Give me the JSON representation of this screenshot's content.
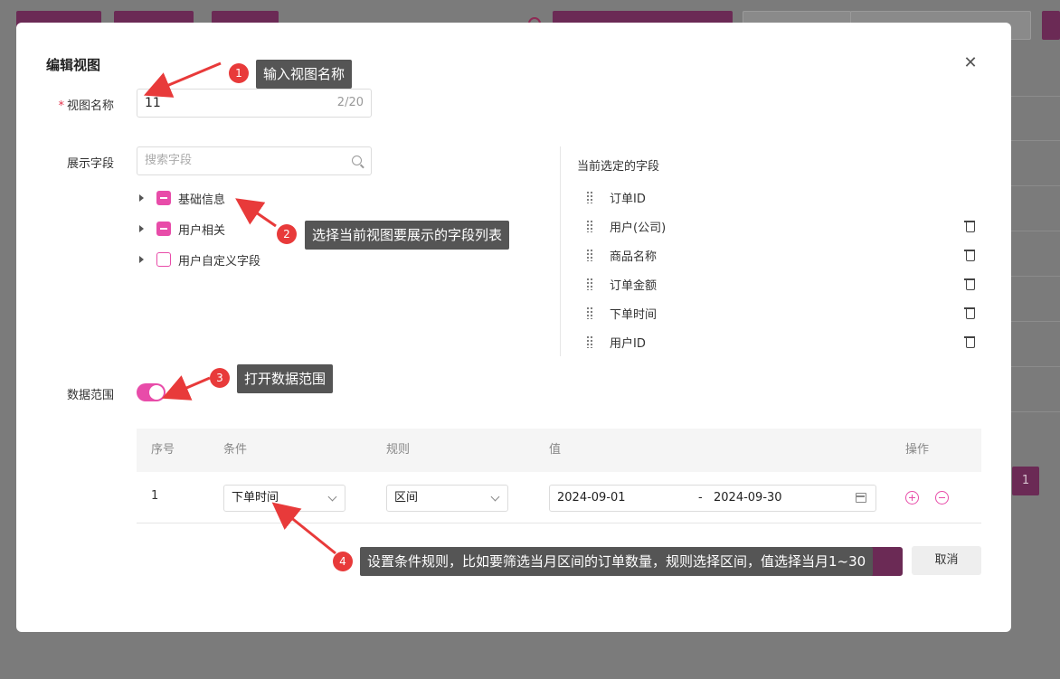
{
  "modal": {
    "title": "编辑视图",
    "close_icon": "close-icon",
    "name_label": "视图名称",
    "name_value": "11",
    "name_count": "2/20",
    "fields_label": "展示字段",
    "search_placeholder": "搜索字段",
    "tree": [
      {
        "label": "基础信息",
        "state": "partial"
      },
      {
        "label": "用户相关",
        "state": "partial"
      },
      {
        "label": "用户自定义字段",
        "state": "unchecked"
      }
    ],
    "selected_title": "当前选定的字段",
    "selected_fields": [
      {
        "label": "订单ID"
      },
      {
        "label": "用户(公司)"
      },
      {
        "label": "商品名称"
      },
      {
        "label": "订单金额"
      },
      {
        "label": "下单时间"
      },
      {
        "label": "用户ID"
      }
    ],
    "range_label": "数据范围",
    "range_enabled": true,
    "table": {
      "headers": [
        "序号",
        "条件",
        "规则",
        "值",
        "操作"
      ],
      "rows": [
        {
          "index": "1",
          "condition": "下单时间",
          "rule": "区间",
          "start": "2024-09-01",
          "sep": "-",
          "end": "2024-09-30"
        }
      ]
    },
    "cancel_label": "取消"
  },
  "background": {
    "page_num": "1"
  },
  "annotations": [
    {
      "num": "1",
      "text": "输入视图名称"
    },
    {
      "num": "2",
      "text": "选择当前视图要展示的字段列表"
    },
    {
      "num": "3",
      "text": "打开数据范围"
    },
    {
      "num": "4",
      "text": "设置条件规则，比如要筛选当月区间的订单数量，规则选择区间，值选择当月1~30"
    }
  ],
  "colors": {
    "accent": "#e84ca9",
    "primary": "#6b2a55",
    "annotation_badge": "#e83a3a"
  }
}
